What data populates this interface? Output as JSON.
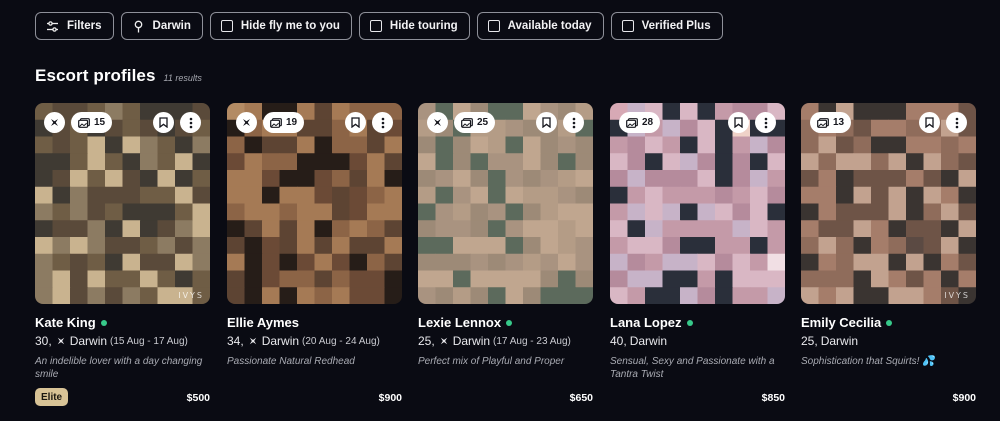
{
  "filters": [
    {
      "label": "Filters",
      "icon": "sliders-icon"
    },
    {
      "label": "Darwin",
      "icon": "location-pin-icon"
    },
    {
      "label": "Hide fly me to you",
      "icon": "checkbox"
    },
    {
      "label": "Hide touring",
      "icon": "checkbox"
    },
    {
      "label": "Available today",
      "icon": "checkbox"
    },
    {
      "label": "Verified Plus",
      "icon": "checkbox"
    }
  ],
  "section": {
    "title": "Escort profiles",
    "count": "11 results"
  },
  "profiles": [
    {
      "name": "Kate King",
      "online": true,
      "age": "30,",
      "fly": true,
      "city": "Darwin",
      "dates": "(15 Aug - 17 Aug)",
      "tagline": "An indelible lover with a day changing smile",
      "badge": "Elite",
      "price": "$500",
      "photos": "15",
      "watermark": "IVYS"
    },
    {
      "name": "Ellie Aymes",
      "online": false,
      "age": "34,",
      "fly": true,
      "city": "Darwin",
      "dates": "(20 Aug - 24 Aug)",
      "tagline": "Passionate Natural Redhead",
      "badge": "",
      "price": "$900",
      "photos": "19",
      "watermark": ""
    },
    {
      "name": "Lexie Lennox",
      "online": true,
      "age": "25,",
      "fly": true,
      "city": "Darwin",
      "dates": "(17 Aug - 23 Aug)",
      "tagline": "Perfect mix of Playful and Proper",
      "badge": "",
      "price": "$650",
      "photos": "25",
      "watermark": ""
    },
    {
      "name": "Lana Lopez",
      "online": true,
      "age": "40,",
      "fly": false,
      "city": "Darwin",
      "dates": "",
      "tagline": "Sensual, Sexy and Passionate with a Tantra Twist",
      "badge": "",
      "price": "$850",
      "photos": "28",
      "watermark": ""
    },
    {
      "name": "Emily Cecilia",
      "online": true,
      "age": "25,",
      "fly": false,
      "city": "Darwin",
      "dates": "",
      "tagline": "Sophistication that Squirts! 💦",
      "badge": "",
      "price": "$900",
      "photos": "13",
      "watermark": "IVYS"
    }
  ],
  "colors": {
    "background": "#0a0b13",
    "online": "#37c98a",
    "elite_badge": "#d8c396"
  }
}
